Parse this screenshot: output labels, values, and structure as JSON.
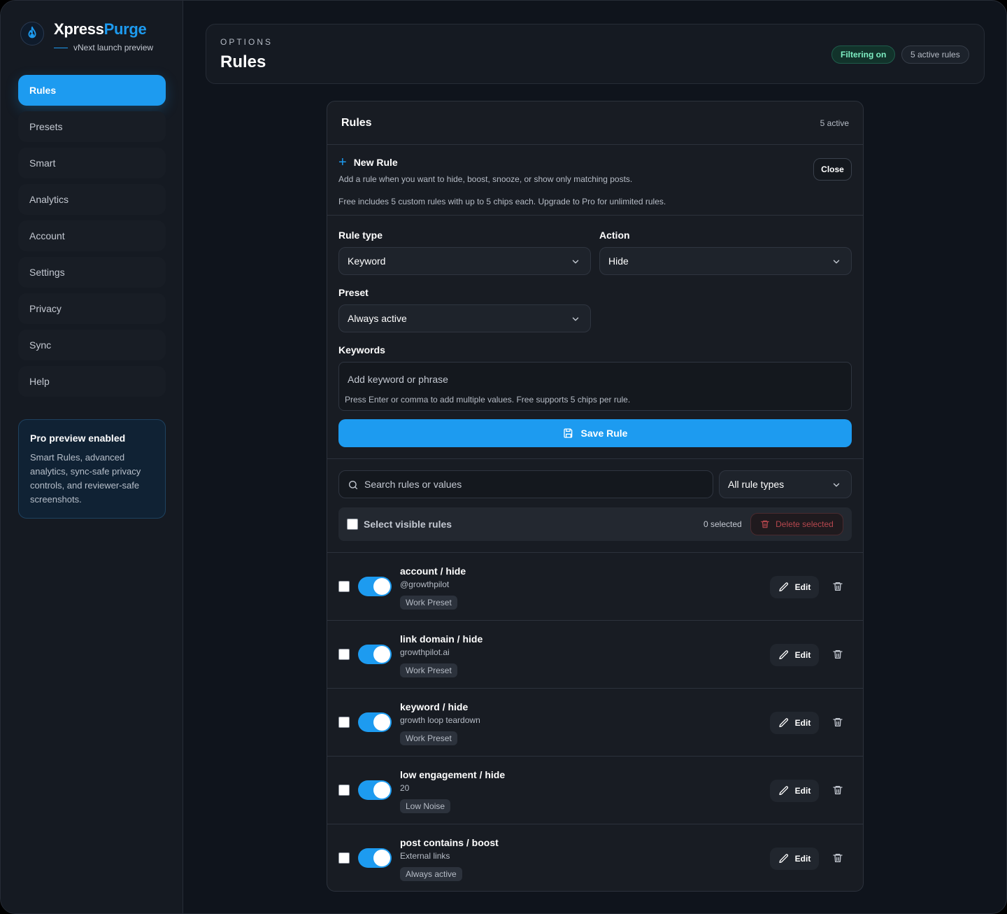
{
  "brand": {
    "name_part1": "Xpress",
    "name_part2": "Purge",
    "subtitle": "vNext launch preview",
    "logo_icon": "flame-icon"
  },
  "sidebar": {
    "items": [
      {
        "label": "Rules",
        "active": true
      },
      {
        "label": "Presets"
      },
      {
        "label": "Smart"
      },
      {
        "label": "Analytics"
      },
      {
        "label": "Account"
      },
      {
        "label": "Settings"
      },
      {
        "label": "Privacy"
      },
      {
        "label": "Sync"
      },
      {
        "label": "Help"
      }
    ],
    "pro_card": {
      "title": "Pro preview enabled",
      "text": "Smart Rules, advanced analytics, sync-safe privacy controls, and reviewer-safe screenshots."
    }
  },
  "header": {
    "eyebrow": "OPTIONS",
    "title": "Rules",
    "badge_filter": "Filtering on",
    "badge_rules": "5 active rules"
  },
  "panel": {
    "title": "Rules",
    "count": "5 active",
    "new_rule": {
      "title": "New Rule",
      "description": "Add a rule when you want to hide, boost, snooze, or show only matching posts.",
      "free_note": "Free includes 5 custom rules with up to 5 chips each. Upgrade to Pro for unlimited rules.",
      "close_label": "Close"
    },
    "form": {
      "rule_type_label": "Rule type",
      "rule_type_value": "Keyword",
      "action_label": "Action",
      "action_value": "Hide",
      "preset_label": "Preset",
      "preset_value": "Always active",
      "keywords_label": "Keywords",
      "keywords_placeholder": "Add keyword or phrase",
      "keywords_hint": "Press Enter or comma to add multiple values. Free supports 5 chips per rule.",
      "save_label": "Save Rule"
    },
    "filter": {
      "search_placeholder": "Search rules or values",
      "type_value": "All rule types",
      "select_label": "Select visible rules",
      "selected_count": "0 selected",
      "delete_label": "Delete selected"
    },
    "rules": [
      {
        "title": "account / hide",
        "value": "@growthpilot",
        "tag": "Work Preset",
        "enabled": true
      },
      {
        "title": "link domain / hide",
        "value": "growthpilot.ai",
        "tag": "Work Preset",
        "enabled": true
      },
      {
        "title": "keyword / hide",
        "value": "growth loop teardown",
        "tag": "Work Preset",
        "enabled": true
      },
      {
        "title": "low engagement / hide",
        "value": "20",
        "tag": "Low Noise",
        "enabled": true
      },
      {
        "title": "post contains / boost",
        "value": "External links",
        "tag": "Always active",
        "enabled": true
      }
    ],
    "edit_label": "Edit"
  },
  "colors": {
    "accent": "#1d9bf0",
    "background": "#0f141c",
    "panel": "#181c23",
    "success": "#7ef0c4",
    "danger": "#b6474e"
  }
}
